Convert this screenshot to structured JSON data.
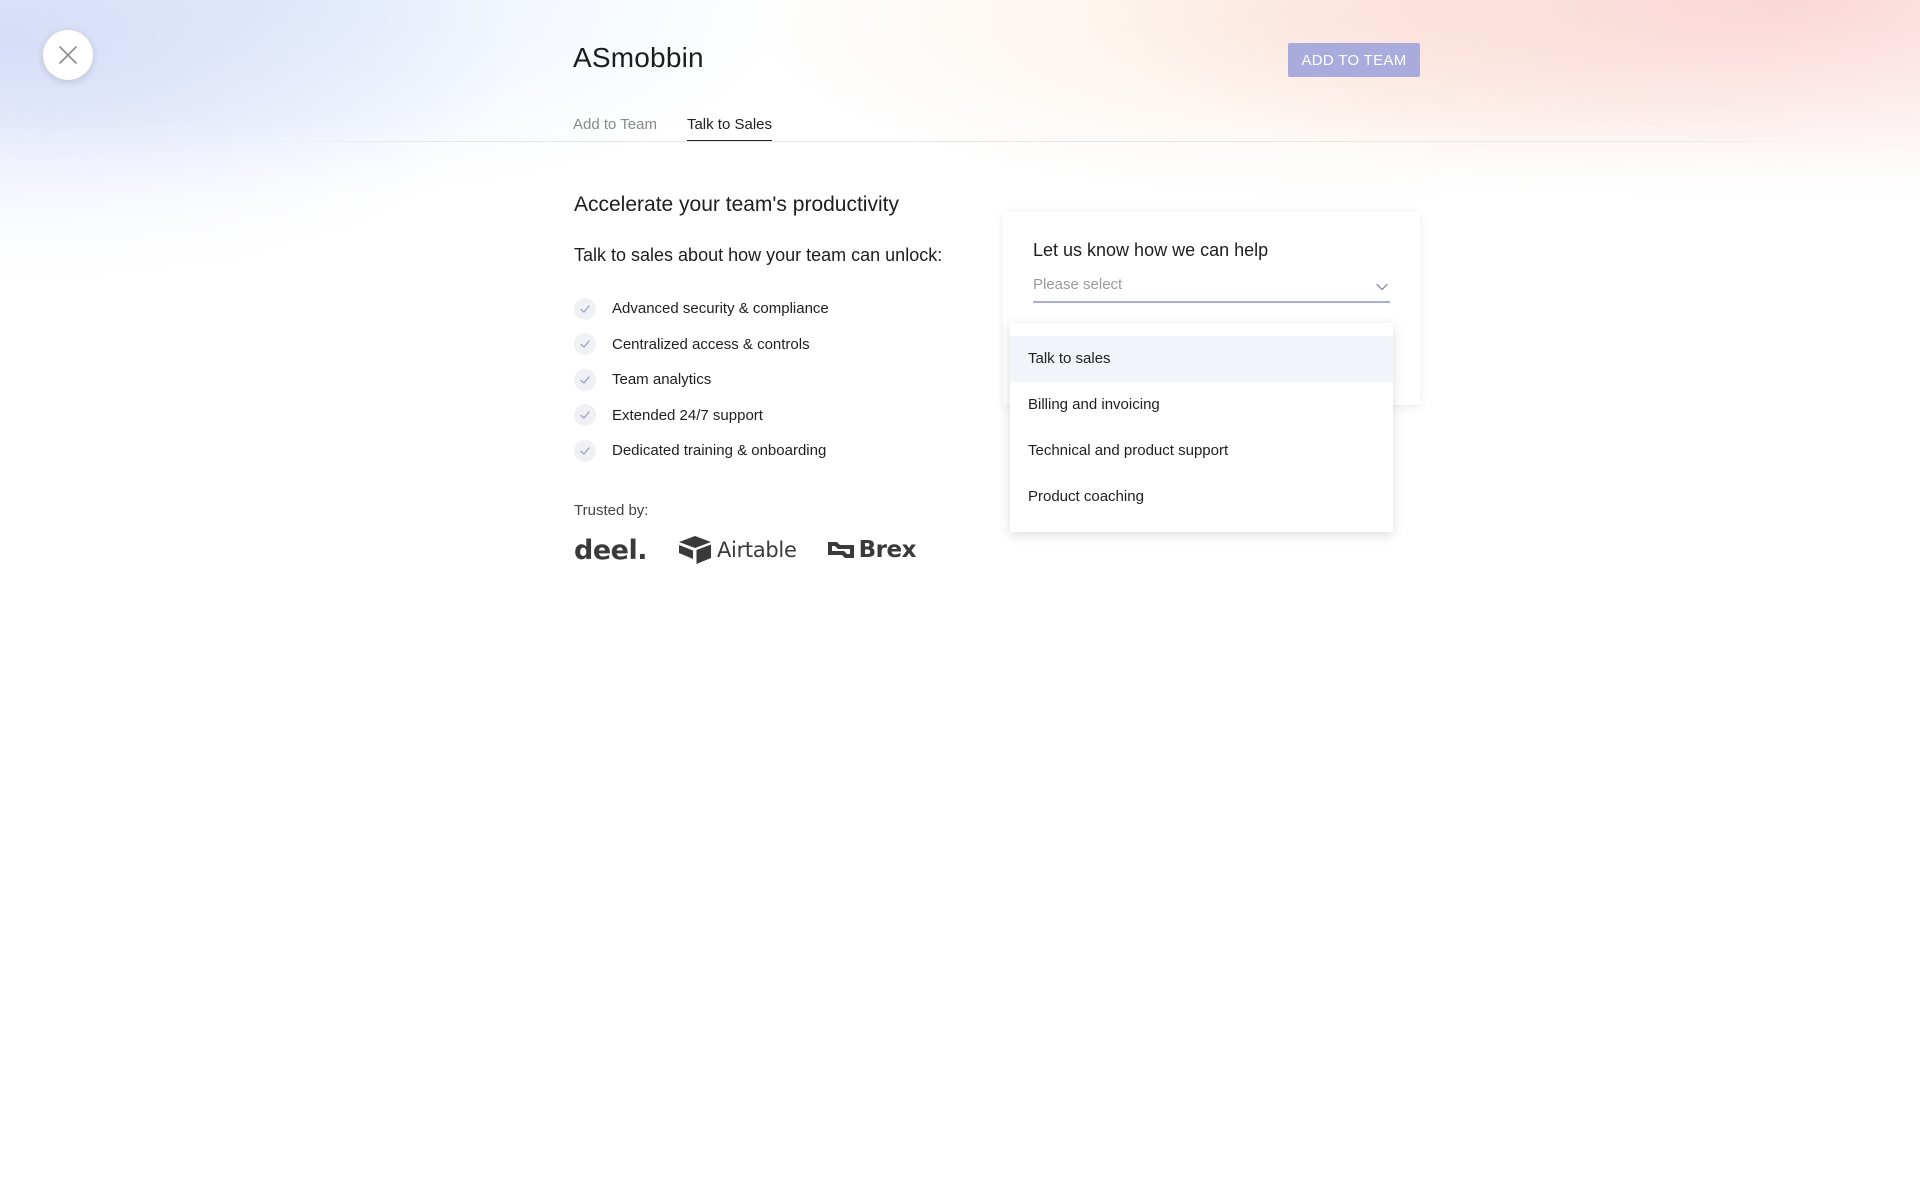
{
  "header": {
    "title": "ASmobbin",
    "add_to_team_button": "ADD TO TEAM"
  },
  "tabs": [
    {
      "label": "Add to Team",
      "active": false
    },
    {
      "label": "Talk to Sales",
      "active": true
    }
  ],
  "main": {
    "headline": "Accelerate your team's productivity",
    "subheadline": "Talk to sales about how your team can unlock:",
    "features": [
      "Advanced security & compliance",
      "Centralized access & controls",
      "Team analytics",
      "Extended 24/7 support",
      "Dedicated training & onboarding"
    ],
    "trusted_label": "Trusted by:",
    "logos": [
      "deel.",
      "Airtable",
      "Brex"
    ]
  },
  "help_form": {
    "title": "Let us know how we can help",
    "select_placeholder": "Please select",
    "options": [
      "Talk to sales",
      "Billing and invoicing",
      "Technical and product support",
      "Product coaching"
    ],
    "highlighted_option": "Talk to sales"
  },
  "colors": {
    "accent": "#a9abdd",
    "highlight": "#f2f4fa",
    "text": "#1f1f1f",
    "muted": "#8a8a8a"
  },
  "icons": {
    "close": "close-icon",
    "check": "check-icon",
    "chevron": "chevron-down-icon"
  }
}
